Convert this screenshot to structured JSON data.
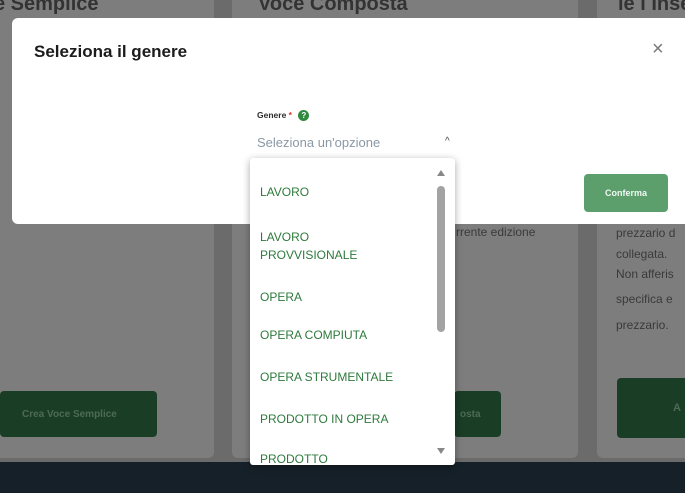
{
  "background": {
    "col1": {
      "heading": "e Semplice",
      "button": "Crea Voce Semplice"
    },
    "col2": {
      "heading": "Voce Composta",
      "text": "rrente edizione",
      "button": "osta"
    },
    "col3": {
      "heading": "ie l  Inse",
      "lines": [
        "prezzario d",
        "collegata.",
        "Non afferis",
        "specifica e",
        "prezzario."
      ],
      "button": "A"
    }
  },
  "modal": {
    "title": "Seleziona il genere",
    "close_label": "×",
    "field": {
      "label": "Genere",
      "required_mark": "*",
      "help_icon": "?",
      "placeholder": "Seleziona un'opzione",
      "chevron": "^"
    },
    "confirm_label": "Conferma"
  },
  "dropdown": {
    "options": [
      "LAVORO",
      "LAVORO PROVVISIONALE",
      "OPERA",
      "OPERA COMPIUTA",
      "OPERA STRUMENTALE",
      "PRODOTTO IN OPERA",
      "PRODOTTO SEMILAVORATO"
    ],
    "visible_option_scroll_fraction": 0.0
  },
  "colors": {
    "option_text": "#2e7a3c",
    "confirm_button": "#5c9e6c",
    "help_icon": "#2f8a3f",
    "required_mark": "#d93025"
  }
}
